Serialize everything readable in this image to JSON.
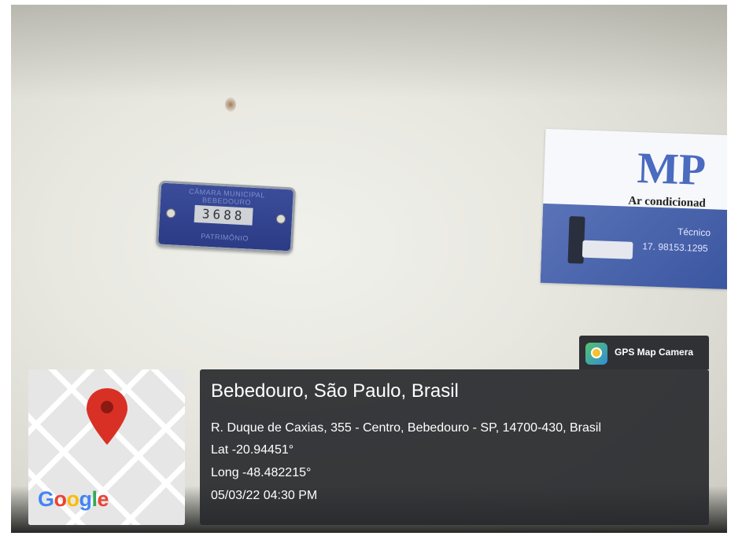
{
  "photo": {
    "asset_tag": {
      "line1": "CÂMARA MUNICIPAL",
      "line2": "BEBEDOURO",
      "number": "3688",
      "line4": "PATRIMÔNIO"
    },
    "business_card": {
      "logo": "MP",
      "subtitle": "Ar condicionad",
      "tecnico": "Técnico",
      "phone": "17. 98153.1295"
    }
  },
  "stamp": {
    "app_name": "GPS Map Camera",
    "icon": "gps-map-camera-app-icon"
  },
  "map": {
    "brand": "Google",
    "pin_icon": "map-pin-icon",
    "pin_color": "#d93025"
  },
  "location": {
    "city": "Bebedouro, São Paulo, Brasil",
    "address": "R. Duque de Caxias, 355 - Centro, Bebedouro - SP, 14700-430, Brasil",
    "lat": "Lat -20.94451°",
    "long": "Long -48.482215°",
    "datetime": "05/03/22 04:30 PM"
  }
}
